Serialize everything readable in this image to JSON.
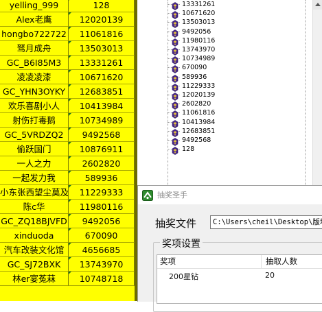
{
  "sheet": {
    "rows": [
      {
        "name": "yelling_999",
        "number": "128"
      },
      {
        "name": "Alex老鹰",
        "number": "12020139"
      },
      {
        "name": "hongbo722722",
        "number": "11061816"
      },
      {
        "name": "驽月成舟",
        "number": "13503013"
      },
      {
        "name": "GC_B6I85M3",
        "number": "13331261"
      },
      {
        "name": "凌凌凌漆",
        "number": "10671620"
      },
      {
        "name": "GC_YHN3OYKY",
        "number": "12683851"
      },
      {
        "name": "欢乐喜剧小人",
        "number": "10413984"
      },
      {
        "name": "射伤打毒鹅",
        "number": "10734989"
      },
      {
        "name": "GC_5VRDZQ2",
        "number": "9492568"
      },
      {
        "name": "偷跃国门",
        "number": "10876911"
      },
      {
        "name": "一人之力",
        "number": "2602820"
      },
      {
        "name": "一起发力我",
        "number": "589936"
      },
      {
        "name": "小东张西望尘莫及",
        "number": "11229333"
      },
      {
        "name": "陈c华",
        "number": "11980116"
      },
      {
        "name": "GC_ZQ18BJVFD",
        "number": "9492056"
      },
      {
        "name": "xinduoda",
        "number": "670090"
      },
      {
        "name": "汽车改装文化馆",
        "number": "4656685"
      },
      {
        "name": "GC_SJ72BXK",
        "number": "13743970"
      },
      {
        "name": "林er宴菟菻",
        "number": "10748718"
      }
    ]
  },
  "tree": {
    "items": [
      "13331261",
      "10671620",
      "13503013",
      "9492056",
      "11980116",
      "13743970",
      "10734989",
      "670090",
      "589936",
      "11229333",
      "12020139",
      "2602820",
      "11061816",
      "10413984",
      "12683851",
      "9492568",
      "128"
    ]
  },
  "dialog": {
    "title": "抽奖圣手",
    "file_label": "抽奖文件",
    "file_path": "C:\\Users\\cheil\\Desktop\\版块",
    "group_title": "奖项设置",
    "table": {
      "headers": {
        "award": "奖项",
        "count": "抽取人数"
      },
      "rows": [
        {
          "award": "200星钻",
          "count": "20"
        }
      ]
    }
  },
  "colors": {
    "sheet_bg": "#ffff00",
    "dialog_bg": "#f0f0f0"
  }
}
